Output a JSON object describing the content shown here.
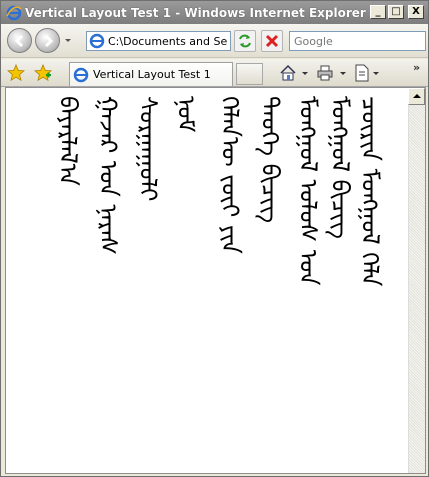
{
  "window": {
    "title": "Vertical Layout Test 1 - Windows Internet Explorer",
    "minimize": "_",
    "maximize": "□",
    "close": "X"
  },
  "address": {
    "url": "C:\\Documents and Se"
  },
  "search": {
    "placeholder": "Google"
  },
  "tab": {
    "label": "Vertical Layout Test 1"
  },
  "page": {
    "lines": [
      "ᠴᠦᠷᠢᠨ ᠮᠣᠩᠭᠣᠯ ᠬᠡᠯᠡ",
      "ᠮᠣᠩᠭᠣᠯ ᠪᠢᠴᠢᠭ",
      "ᠮᠣᠩᠭᠣᠯ ᠤᠯᠤᠰ ᠤᠨ",
      "ᠲᠡᠦᠬᠡ ᠪᠢᠴᠢᠭ",
      "ᠬᠡᠯᠡᠨ᠎ᠦ ᠵᠦᠢ ᠶᠢᠨ",
      "ᠨᠣᠮ",
      "ᠰᠤᠷᠭᠠᠭᠤᠯᠢ",
      "ᠭᠠᠵᠠᠷ ᠤᠨ ᠨᠡᠷᠡᠰ",
      "ᠪᠠᠶᠠᠷᠯᠠᠯ᠎ᠠ"
    ]
  },
  "icons": {
    "ie": "ie-icon",
    "back": "back-arrow-icon",
    "forward": "forward-arrow-icon",
    "refresh": "refresh-icon",
    "stop": "stop-icon",
    "favorites": "favorites-star-icon",
    "add_favorite": "add-favorite-icon",
    "home": "home-icon",
    "print": "print-icon",
    "page": "page-icon"
  }
}
